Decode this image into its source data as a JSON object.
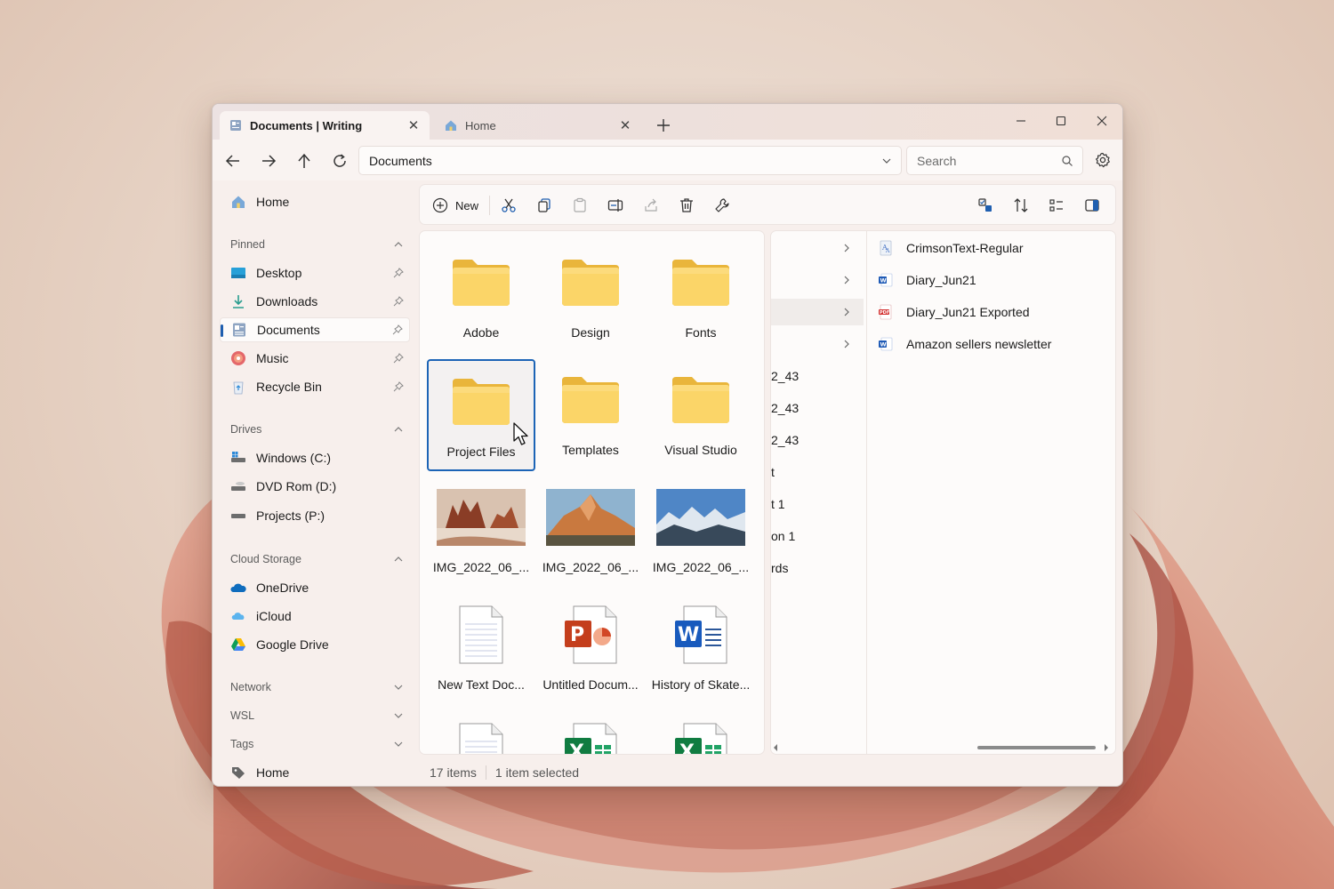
{
  "tabs": [
    {
      "label": "Documents | Writing",
      "icon": "documents-icon",
      "active": true
    },
    {
      "label": "Home",
      "icon": "home-icon",
      "active": false
    }
  ],
  "window_controls": {
    "minimize": "minimize-icon",
    "maximize": "maximize-icon",
    "close": "close-icon"
  },
  "address": {
    "path": "Documents"
  },
  "search": {
    "placeholder": "Search"
  },
  "toolbar": {
    "new_label": "New"
  },
  "sidebar": {
    "home": "Home",
    "pinned_header": "Pinned",
    "pinned": [
      {
        "label": "Desktop",
        "icon": "desktop-icon"
      },
      {
        "label": "Downloads",
        "icon": "download-icon"
      },
      {
        "label": "Documents",
        "icon": "documents-icon",
        "selected": true
      },
      {
        "label": "Music",
        "icon": "music-icon"
      },
      {
        "label": "Recycle Bin",
        "icon": "recycle-bin-icon"
      }
    ],
    "drives_header": "Drives",
    "drives": [
      {
        "label": "Windows (C:)",
        "icon": "drive-icon"
      },
      {
        "label": "DVD Rom (D:)",
        "icon": "dvd-drive-icon"
      },
      {
        "label": "Projects (P:)",
        "icon": "drive-icon"
      }
    ],
    "cloud_header": "Cloud Storage",
    "cloud": [
      {
        "label": "OneDrive",
        "icon": "onedrive-icon"
      },
      {
        "label": "iCloud",
        "icon": "icloud-icon"
      },
      {
        "label": "Google Drive",
        "icon": "google-drive-icon"
      }
    ],
    "network_header": "Network",
    "wsl_header": "WSL",
    "tags_header": "Tags",
    "tags": [
      {
        "label": "Home",
        "icon": "tag-icon"
      }
    ]
  },
  "grid_items": [
    {
      "label": "Adobe",
      "type": "folder"
    },
    {
      "label": "Design",
      "type": "folder"
    },
    {
      "label": "Fonts",
      "type": "folder"
    },
    {
      "label": "Project Files",
      "type": "folder",
      "selected": true
    },
    {
      "label": "Templates",
      "type": "folder"
    },
    {
      "label": "Visual Studio",
      "type": "folder"
    },
    {
      "label": "IMG_2022_06_...",
      "type": "image"
    },
    {
      "label": "IMG_2022_06_...",
      "type": "image"
    },
    {
      "label": "IMG_2022_06_...",
      "type": "image"
    },
    {
      "label": "New Text Doc...",
      "type": "text"
    },
    {
      "label": "Untitled Docum...",
      "type": "powerpoint"
    },
    {
      "label": "History of Skate...",
      "type": "word"
    },
    {
      "label": "",
      "type": "text"
    },
    {
      "label": "",
      "type": "excel"
    },
    {
      "label": "",
      "type": "excel"
    }
  ],
  "column_view": {
    "col1_fragments": [
      "",
      "",
      "",
      "",
      "2_43",
      "2_43",
      "2_43",
      "t",
      "t 1",
      "on 1",
      "rds"
    ],
    "col2_files": [
      {
        "label": "CrimsonText-Regular",
        "icon": "font-file-icon"
      },
      {
        "label": "Diary_Jun21",
        "icon": "word-file-icon"
      },
      {
        "label": "Diary_Jun21 Exported",
        "icon": "pdf-file-icon"
      },
      {
        "label": "Amazon sellers newsletter",
        "icon": "word-file-icon"
      }
    ]
  },
  "status": {
    "items": "17 items",
    "selected": "1 item selected"
  },
  "colors": {
    "accent": "#1c64b6",
    "folder": "#f9d35e",
    "window_bg": "#f7efec"
  }
}
